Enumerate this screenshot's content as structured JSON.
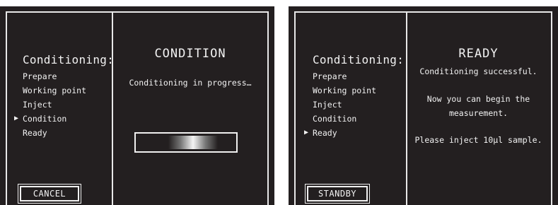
{
  "left_screen": {
    "menu_title": "Conditioning:",
    "menu_items": [
      "Prepare",
      "Working point",
      "Inject",
      "Condition",
      "Ready"
    ],
    "arrow": "▶",
    "heading": "CONDITION",
    "status": "Conditioning in progress…",
    "progress": 0.5,
    "button_label": "CANCEL"
  },
  "right_screen": {
    "menu_title": "Conditioning:",
    "menu_items": [
      "Prepare",
      "Working point",
      "Inject",
      "Condition",
      "Ready"
    ],
    "arrow": "▶",
    "heading": "READY",
    "line1": "Conditioning successful.",
    "line2": "Now you can begin the",
    "line3": "measurement.",
    "line4": "Please inject 10µl sample.",
    "button_label": "STANDBY"
  },
  "colors": {
    "screen_bg": "#231f20",
    "foreground": "#f2f2f2"
  }
}
